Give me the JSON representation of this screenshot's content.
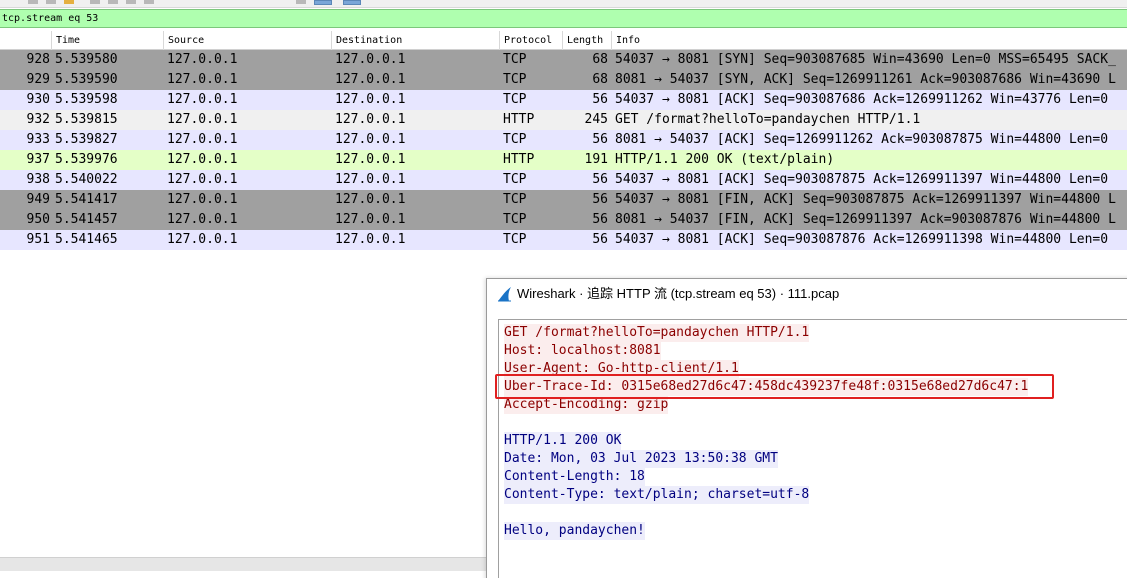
{
  "colors": {
    "filter_bg": "#afffaf",
    "row_gray_bg": "#a0a0a0",
    "row_tcp_bg": "#e7e6ff",
    "row_http_req_bg": "#e4ffc7",
    "row_selected_bg": "#f0f0f0",
    "request_text": "#8b0000",
    "response_text": "#000080",
    "highlight_border": "#e02020"
  },
  "filter": {
    "value": "tcp.stream eq 53"
  },
  "columns": [
    "Time",
    "Source",
    "Destination",
    "Protocol",
    "Length",
    "Info"
  ],
  "packets": [
    {
      "no": "928",
      "time": "5.539580",
      "src": "127.0.0.1",
      "dst": "127.0.0.1",
      "proto": "TCP",
      "len": "68",
      "info": "54037 → 8081 [SYN] Seq=903087685 Win=43690 Len=0 MSS=65495 SACK_",
      "style": "gray"
    },
    {
      "no": "929",
      "time": "5.539590",
      "src": "127.0.0.1",
      "dst": "127.0.0.1",
      "proto": "TCP",
      "len": "68",
      "info": "8081 → 54037 [SYN, ACK] Seq=1269911261 Ack=903087686 Win=43690 L",
      "style": "gray"
    },
    {
      "no": "930",
      "time": "5.539598",
      "src": "127.0.0.1",
      "dst": "127.0.0.1",
      "proto": "TCP",
      "len": "56",
      "info": "54037 → 8081 [ACK] Seq=903087686 Ack=1269911262 Win=43776 Len=0",
      "style": "tcp"
    },
    {
      "no": "932",
      "time": "5.539815",
      "src": "127.0.0.1",
      "dst": "127.0.0.1",
      "proto": "HTTP",
      "len": "245",
      "info": "GET /format?helloTo=pandaychen HTTP/1.1",
      "style": "selected"
    },
    {
      "no": "933",
      "time": "5.539827",
      "src": "127.0.0.1",
      "dst": "127.0.0.1",
      "proto": "TCP",
      "len": "56",
      "info": "8081 → 54037 [ACK] Seq=1269911262 Ack=903087875 Win=44800 Len=0",
      "style": "tcp"
    },
    {
      "no": "937",
      "time": "5.539976",
      "src": "127.0.0.1",
      "dst": "127.0.0.1",
      "proto": "HTTP",
      "len": "191",
      "info": "HTTP/1.1 200 OK  (text/plain)",
      "style": "http"
    },
    {
      "no": "938",
      "time": "5.540022",
      "src": "127.0.0.1",
      "dst": "127.0.0.1",
      "proto": "TCP",
      "len": "56",
      "info": "54037 → 8081 [ACK] Seq=903087875 Ack=1269911397 Win=44800 Len=0",
      "style": "tcp"
    },
    {
      "no": "949",
      "time": "5.541417",
      "src": "127.0.0.1",
      "dst": "127.0.0.1",
      "proto": "TCP",
      "len": "56",
      "info": "54037 → 8081 [FIN, ACK] Seq=903087875 Ack=1269911397 Win=44800 L",
      "style": "gray"
    },
    {
      "no": "950",
      "time": "5.541457",
      "src": "127.0.0.1",
      "dst": "127.0.0.1",
      "proto": "TCP",
      "len": "56",
      "info": "8081 → 54037 [FIN, ACK] Seq=1269911397 Ack=903087876 Win=44800 L",
      "style": "gray"
    },
    {
      "no": "951",
      "time": "5.541465",
      "src": "127.0.0.1",
      "dst": "127.0.0.1",
      "proto": "TCP",
      "len": "56",
      "info": "54037 → 8081 [ACK] Seq=903087876 Ack=1269911398 Win=44800 Len=0",
      "style": "tcp"
    }
  ],
  "dialog": {
    "title": "Wireshark · 追踪 HTTP 流 (tcp.stream eq 53) · 111.pcap",
    "icon": "wireshark-fin-icon",
    "lines": [
      {
        "text": "GET /format?helloTo=pandaychen HTTP/1.1",
        "kind": "req"
      },
      {
        "text": "Host: localhost:8081",
        "kind": "req"
      },
      {
        "text": "User-Agent: Go-http-client/1.1",
        "kind": "req"
      },
      {
        "text": "Uber-Trace-Id: 0315e68ed27d6c47:458dc439237fe48f:0315e68ed27d6c47:1",
        "kind": "req"
      },
      {
        "text": "Accept-Encoding: gzip",
        "kind": "req"
      },
      {
        "text": "",
        "kind": "blank"
      },
      {
        "text": "HTTP/1.1 200 OK",
        "kind": "resp"
      },
      {
        "text": "Date: Mon, 03 Jul 2023 13:50:38 GMT",
        "kind": "resp"
      },
      {
        "text": "Content-Length: 18",
        "kind": "resp"
      },
      {
        "text": "Content-Type: text/plain; charset=utf-8",
        "kind": "resp"
      },
      {
        "text": "",
        "kind": "blank"
      },
      {
        "text": "Hello, pandaychen!",
        "kind": "resp"
      }
    ]
  }
}
